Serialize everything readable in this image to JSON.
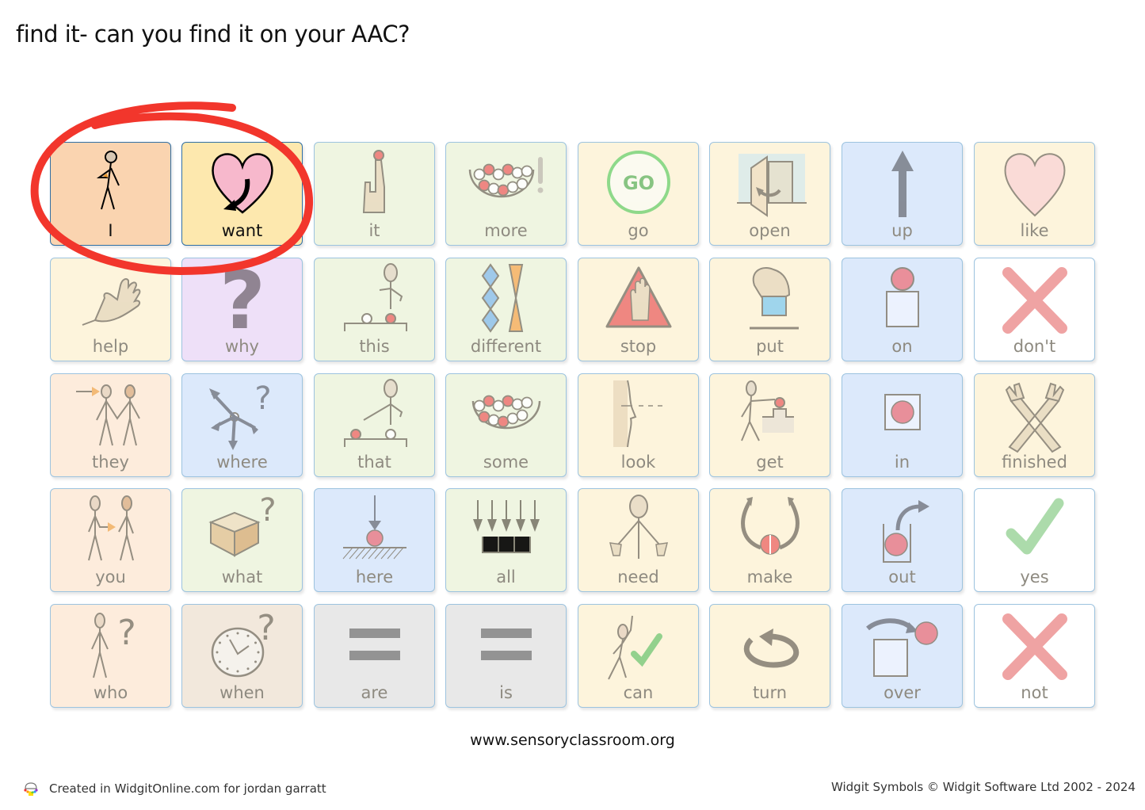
{
  "title": "find it- can you find it on your AAC?",
  "highlight_color": "#f2362c",
  "cells": [
    {
      "label": "I",
      "bg": "#fad4b0",
      "icon": "person-pointing-self-icon",
      "active": true
    },
    {
      "label": "want",
      "bg": "#fde8ae",
      "icon": "heart-arrow-icon",
      "active": true
    },
    {
      "label": "it",
      "bg": "#eff5e1",
      "icon": "finger-pointing-icon"
    },
    {
      "label": "more",
      "bg": "#eff5e1",
      "icon": "bowl-balls-exclamation-icon"
    },
    {
      "label": "go",
      "bg": "#fdf4dc",
      "icon": "go-circle-icon"
    },
    {
      "label": "open",
      "bg": "#fdf4dc",
      "icon": "door-open-icon"
    },
    {
      "label": "up",
      "bg": "#dce9fb",
      "icon": "arrow-up-icon"
    },
    {
      "label": "like",
      "bg": "#fdf4dc",
      "icon": "heart-icon"
    },
    {
      "label": "help",
      "bg": "#fdf4dc",
      "icon": "hand-icon"
    },
    {
      "label": "why",
      "bg": "#eee0f8",
      "icon": "question-mark-icon"
    },
    {
      "label": "this",
      "bg": "#eff5e1",
      "icon": "person-pointing-near-icon"
    },
    {
      "label": "different",
      "bg": "#eff5e1",
      "icon": "diamonds-hourglass-icon"
    },
    {
      "label": "stop",
      "bg": "#fdf4dc",
      "icon": "stop-hand-triangle-icon"
    },
    {
      "label": "put",
      "bg": "#fdf4dc",
      "icon": "hand-putting-box-icon"
    },
    {
      "label": "on",
      "bg": "#dce9fb",
      "icon": "ball-on-box-icon"
    },
    {
      "label": "don't",
      "bg": "#ffffff",
      "icon": "cross-icon"
    },
    {
      "label": "they",
      "bg": "#fdecdc",
      "icon": "two-people-icon"
    },
    {
      "label": "where",
      "bg": "#dce9fb",
      "icon": "arrows-question-icon"
    },
    {
      "label": "that",
      "bg": "#eff5e1",
      "icon": "person-pointing-far-icon"
    },
    {
      "label": "some",
      "bg": "#eff5e1",
      "icon": "bowl-balls-icon"
    },
    {
      "label": "look",
      "bg": "#fdf4dc",
      "icon": "face-looking-icon"
    },
    {
      "label": "get",
      "bg": "#fdf4dc",
      "icon": "person-getting-icon"
    },
    {
      "label": "in",
      "bg": "#dce9fb",
      "icon": "ball-in-box-icon"
    },
    {
      "label": "finished",
      "bg": "#fdf4dc",
      "icon": "crossed-arms-icon"
    },
    {
      "label": "you",
      "bg": "#fdecdc",
      "icon": "person-to-person-icon"
    },
    {
      "label": "what",
      "bg": "#eff5e1",
      "icon": "box-question-icon"
    },
    {
      "label": "here",
      "bg": "#dce9fb",
      "icon": "arrow-down-ball-icon"
    },
    {
      "label": "all",
      "bg": "#eff5e1",
      "icon": "many-arrows-down-icon"
    },
    {
      "label": "need",
      "bg": "#fdf4dc",
      "icon": "person-needing-icon"
    },
    {
      "label": "make",
      "bg": "#fdf4dc",
      "icon": "arrows-joining-ball-icon"
    },
    {
      "label": "out",
      "bg": "#dce9fb",
      "icon": "ball-out-box-icon"
    },
    {
      "label": "yes",
      "bg": "#ffffff",
      "icon": "check-icon"
    },
    {
      "label": "who",
      "bg": "#fdecdc",
      "icon": "person-question-icon"
    },
    {
      "label": "when",
      "bg": "#f2e8dc",
      "icon": "clock-question-icon"
    },
    {
      "label": "are",
      "bg": "#e8e8e8",
      "icon": "equals-icon"
    },
    {
      "label": "is",
      "bg": "#e8e8e8",
      "icon": "equals-icon"
    },
    {
      "label": "can",
      "bg": "#fdf4dc",
      "icon": "person-check-icon"
    },
    {
      "label": "turn",
      "bg": "#fdf4dc",
      "icon": "rotate-arrow-icon"
    },
    {
      "label": "over",
      "bg": "#dce9fb",
      "icon": "ball-over-box-icon"
    },
    {
      "label": "not",
      "bg": "#ffffff",
      "icon": "cross-icon"
    }
  ],
  "footer": {
    "site": "www.sensoryclassroom.org",
    "created": "Created in WidgitOnline.com for jordan garratt",
    "copyright": "Widgit Symbols © Widgit Software Ltd 2002 - 2024"
  }
}
